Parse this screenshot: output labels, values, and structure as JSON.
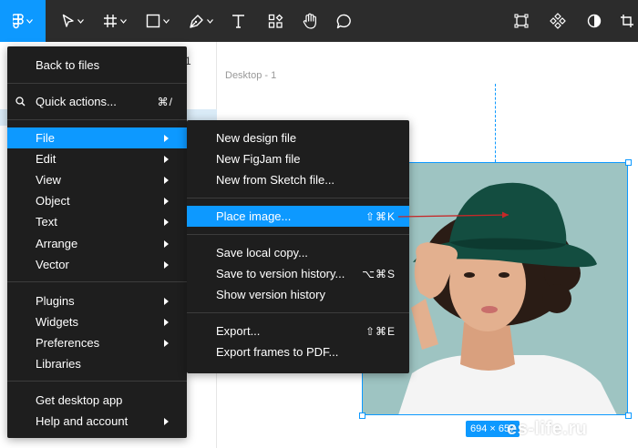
{
  "canvas": {
    "frame_label": "Desktop - 1",
    "page_peek": "1",
    "selection_size": "694 × 657",
    "watermark": "es-life.ru"
  },
  "toolbar": {
    "tools": [
      "figma-menu",
      "move",
      "frame",
      "shape",
      "pen",
      "text",
      "resources",
      "hand",
      "comment"
    ],
    "right_tools": [
      "component",
      "instance",
      "contrast",
      "crop"
    ]
  },
  "main_menu": {
    "items": [
      {
        "label": "Back to files"
      },
      {
        "label": "Quick actions...",
        "shortcut": "⌘/"
      },
      {
        "label": "File"
      },
      {
        "label": "Edit"
      },
      {
        "label": "View"
      },
      {
        "label": "Object"
      },
      {
        "label": "Text"
      },
      {
        "label": "Arrange"
      },
      {
        "label": "Vector"
      },
      {
        "label": "Plugins"
      },
      {
        "label": "Widgets"
      },
      {
        "label": "Preferences"
      },
      {
        "label": "Libraries"
      },
      {
        "label": "Get desktop app"
      },
      {
        "label": "Help and account"
      }
    ]
  },
  "file_menu": {
    "items": [
      {
        "label": "New design file"
      },
      {
        "label": "New FigJam file"
      },
      {
        "label": "New from Sketch file..."
      },
      {
        "label": "Place image...",
        "shortcut": "⇧⌘K"
      },
      {
        "label": "Save local copy..."
      },
      {
        "label": "Save to version history...",
        "shortcut": "⌥⌘S"
      },
      {
        "label": "Show version history"
      },
      {
        "label": "Export...",
        "shortcut": "⇧⌘E"
      },
      {
        "label": "Export frames to PDF..."
      }
    ]
  },
  "colors": {
    "accent": "#0d99ff",
    "toolbar": "#2c2c2c",
    "menu": "#1e1e1e",
    "annotation_arrow": "#c62828"
  }
}
